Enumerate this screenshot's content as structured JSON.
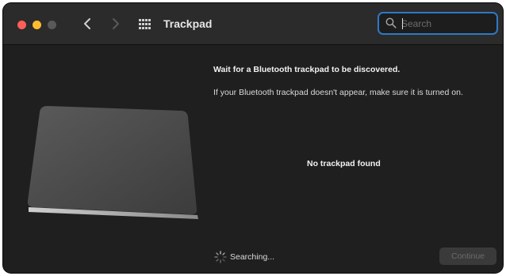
{
  "window": {
    "title": "Trackpad",
    "back_icon": "chevron-left-icon",
    "forward_icon": "chevron-right-icon",
    "grid_icon": "show-all-grid-icon"
  },
  "search": {
    "placeholder": "Search",
    "value": ""
  },
  "content": {
    "heading": "Wait for a Bluetooth trackpad to be discovered.",
    "description": "If your Bluetooth trackpad doesn't appear, make sure it is turned on.",
    "status": "No trackpad found",
    "searching_label": "Searching...",
    "continue_label": "Continue"
  },
  "colors": {
    "window_bg": "#1f1f1f",
    "titlebar_bg": "#2b2b2b",
    "search_focus": "#2e79c6",
    "close": "#ff5f57",
    "minimize": "#febc2e"
  }
}
